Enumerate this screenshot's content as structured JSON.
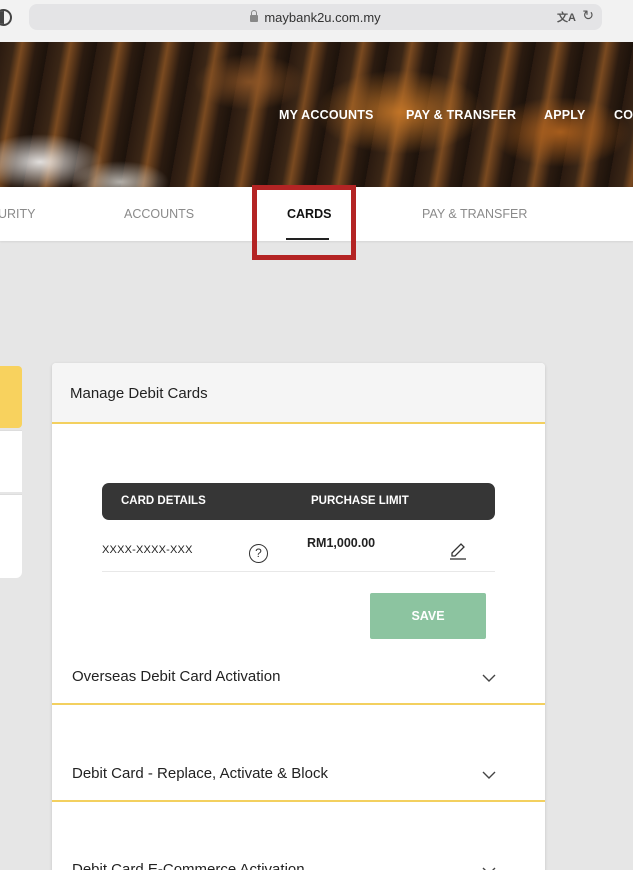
{
  "browser": {
    "url": "maybank2u.com.my",
    "translate_icon": "translate-icon",
    "reload_icon": "reload-icon"
  },
  "nav": {
    "items": [
      "MY ACCOUNTS",
      "PAY & TRANSFER",
      "APPLY",
      "CO"
    ]
  },
  "subnav": {
    "items": [
      "URITY",
      "ACCOUNTS",
      "CARDS",
      "PAY & TRANSFER"
    ],
    "active": "CARDS"
  },
  "highlight_color": "#b42424",
  "accent_color": "#f3d05f",
  "manage": {
    "title": "Manage Debit Cards",
    "table_headers": [
      "CARD DETAILS",
      "PURCHASE LIMIT"
    ],
    "rows": [
      {
        "card": "XXXX-XXXX-XXX",
        "limit": "RM1,000.00"
      }
    ],
    "save_label": "SAVE"
  },
  "sections": [
    {
      "title": "Overseas Debit Card Activation"
    },
    {
      "title": "Debit Card - Replace, Activate & Block"
    },
    {
      "title": "Debit Card E-Commerce Activation"
    }
  ]
}
